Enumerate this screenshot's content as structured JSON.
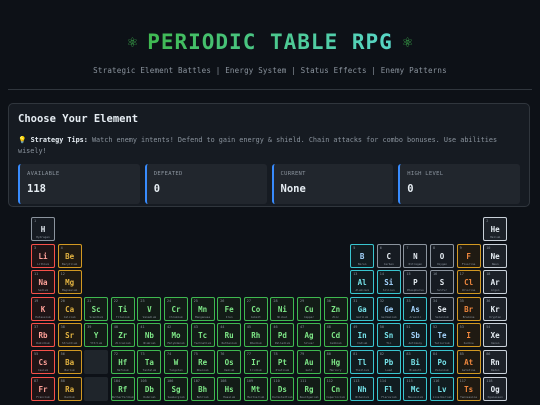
{
  "header": {
    "icon_left": "atom-icon",
    "icon_right": "atom-icon",
    "title": "PERIODIC TABLE RPG",
    "subtitle": "Strategic Element Battles | Energy System | Status Effects | Enemy Patterns"
  },
  "panel": {
    "title": "Choose Your Element",
    "tips_icon": "lightbulb-icon",
    "tips_label": "Strategy Tips:",
    "tips_text": " Watch enemy intents! Defend to gain energy & shield. Chain attacks for combo bonuses. Use abilities wisely!",
    "stats": [
      {
        "label": "AVAILABLE",
        "value": "118"
      },
      {
        "label": "DEFEATED",
        "value": "0"
      },
      {
        "label": "CURRENT",
        "value": "None"
      },
      {
        "label": "HIGH LEVEL",
        "value": "0"
      }
    ]
  },
  "colors": {
    "alkali": "#f85149",
    "alkaline": "#d29922",
    "transition": "#3fb950",
    "post": "#39c5cf",
    "nonmetal": "#8b949e",
    "halogen": "#d29922",
    "noble": "#c9d1d9",
    "stat_accent": "#388bfd"
  },
  "elements": [
    {
      "n": 1,
      "s": "H",
      "name": "Hydrogen",
      "cat": "nonmetal",
      "r": 1,
      "c": 1
    },
    {
      "n": 2,
      "s": "He",
      "name": "Helium",
      "cat": "noble",
      "r": 1,
      "c": 18
    },
    {
      "n": 3,
      "s": "Li",
      "name": "Lithium",
      "cat": "alkali",
      "r": 2,
      "c": 1
    },
    {
      "n": 4,
      "s": "Be",
      "name": "Beryllium",
      "cat": "alkaline",
      "r": 2,
      "c": 2
    },
    {
      "n": 5,
      "s": "B",
      "name": "Boron",
      "cat": "metalloid",
      "r": 2,
      "c": 13
    },
    {
      "n": 6,
      "s": "C",
      "name": "Carbon",
      "cat": "nonmetal",
      "r": 2,
      "c": 14
    },
    {
      "n": 7,
      "s": "N",
      "name": "Nitrogen",
      "cat": "nonmetal",
      "r": 2,
      "c": 15
    },
    {
      "n": 8,
      "s": "O",
      "name": "Oxygen",
      "cat": "nonmetal",
      "r": 2,
      "c": 16
    },
    {
      "n": 9,
      "s": "F",
      "name": "Fluorine",
      "cat": "halogen",
      "r": 2,
      "c": 17
    },
    {
      "n": 10,
      "s": "Ne",
      "name": "Neon",
      "cat": "noble",
      "r": 2,
      "c": 18
    },
    {
      "n": 11,
      "s": "Na",
      "name": "Sodium",
      "cat": "alkali",
      "r": 3,
      "c": 1
    },
    {
      "n": 12,
      "s": "Mg",
      "name": "Magnesium",
      "cat": "alkaline",
      "r": 3,
      "c": 2
    },
    {
      "n": 13,
      "s": "Al",
      "name": "Aluminum",
      "cat": "post",
      "r": 3,
      "c": 13
    },
    {
      "n": 14,
      "s": "Si",
      "name": "Silicon",
      "cat": "metalloid",
      "r": 3,
      "c": 14
    },
    {
      "n": 15,
      "s": "P",
      "name": "Phosphorus",
      "cat": "nonmetal",
      "r": 3,
      "c": 15
    },
    {
      "n": 16,
      "s": "S",
      "name": "Sulfur",
      "cat": "nonmetal",
      "r": 3,
      "c": 16
    },
    {
      "n": 17,
      "s": "Cl",
      "name": "Chlorine",
      "cat": "halogen",
      "r": 3,
      "c": 17
    },
    {
      "n": 18,
      "s": "Ar",
      "name": "Argon",
      "cat": "noble",
      "r": 3,
      "c": 18
    },
    {
      "n": 19,
      "s": "K",
      "name": "Potassium",
      "cat": "alkali",
      "r": 4,
      "c": 1
    },
    {
      "n": 20,
      "s": "Ca",
      "name": "Calcium",
      "cat": "alkaline",
      "r": 4,
      "c": 2
    },
    {
      "n": 21,
      "s": "Sc",
      "name": "Scandium",
      "cat": "transition",
      "r": 4,
      "c": 3
    },
    {
      "n": 22,
      "s": "Ti",
      "name": "Titanium",
      "cat": "transition",
      "r": 4,
      "c": 4
    },
    {
      "n": 23,
      "s": "V",
      "name": "Vanadium",
      "cat": "transition",
      "r": 4,
      "c": 5
    },
    {
      "n": 24,
      "s": "Cr",
      "name": "Chromium",
      "cat": "transition",
      "r": 4,
      "c": 6
    },
    {
      "n": 25,
      "s": "Mn",
      "name": "Manganese",
      "cat": "transition",
      "r": 4,
      "c": 7
    },
    {
      "n": 26,
      "s": "Fe",
      "name": "Iron",
      "cat": "transition",
      "r": 4,
      "c": 8
    },
    {
      "n": 27,
      "s": "Co",
      "name": "Cobalt",
      "cat": "transition",
      "r": 4,
      "c": 9
    },
    {
      "n": 28,
      "s": "Ni",
      "name": "Nickel",
      "cat": "transition",
      "r": 4,
      "c": 10
    },
    {
      "n": 29,
      "s": "Cu",
      "name": "Copper",
      "cat": "transition",
      "r": 4,
      "c": 11
    },
    {
      "n": 30,
      "s": "Zn",
      "name": "Zinc",
      "cat": "transition",
      "r": 4,
      "c": 12
    },
    {
      "n": 31,
      "s": "Ga",
      "name": "Gallium",
      "cat": "post",
      "r": 4,
      "c": 13
    },
    {
      "n": 32,
      "s": "Ge",
      "name": "Germanium",
      "cat": "metalloid",
      "r": 4,
      "c": 14
    },
    {
      "n": 33,
      "s": "As",
      "name": "Arsenic",
      "cat": "metalloid",
      "r": 4,
      "c": 15
    },
    {
      "n": 34,
      "s": "Se",
      "name": "Selenium",
      "cat": "nonmetal",
      "r": 4,
      "c": 16
    },
    {
      "n": 35,
      "s": "Br",
      "name": "Bromine",
      "cat": "halogen",
      "r": 4,
      "c": 17
    },
    {
      "n": 36,
      "s": "Kr",
      "name": "Krypton",
      "cat": "noble",
      "r": 4,
      "c": 18
    },
    {
      "n": 37,
      "s": "Rb",
      "name": "Rubidium",
      "cat": "alkali",
      "r": 5,
      "c": 1
    },
    {
      "n": 38,
      "s": "Sr",
      "name": "Strontium",
      "cat": "alkaline",
      "r": 5,
      "c": 2
    },
    {
      "n": 39,
      "s": "Y",
      "name": "Yttrium",
      "cat": "transition",
      "r": 5,
      "c": 3
    },
    {
      "n": 40,
      "s": "Zr",
      "name": "Zirconium",
      "cat": "transition",
      "r": 5,
      "c": 4
    },
    {
      "n": 41,
      "s": "Nb",
      "name": "Niobium",
      "cat": "transition",
      "r": 5,
      "c": 5
    },
    {
      "n": 42,
      "s": "Mo",
      "name": "Molybdenum",
      "cat": "transition",
      "r": 5,
      "c": 6
    },
    {
      "n": 43,
      "s": "Tc",
      "name": "Technetium",
      "cat": "transition",
      "r": 5,
      "c": 7
    },
    {
      "n": 44,
      "s": "Ru",
      "name": "Ruthenium",
      "cat": "transition",
      "r": 5,
      "c": 8
    },
    {
      "n": 45,
      "s": "Rh",
      "name": "Rhodium",
      "cat": "transition",
      "r": 5,
      "c": 9
    },
    {
      "n": 46,
      "s": "Pd",
      "name": "Palladium",
      "cat": "transition",
      "r": 5,
      "c": 10
    },
    {
      "n": 47,
      "s": "Ag",
      "name": "Silver",
      "cat": "transition",
      "r": 5,
      "c": 11
    },
    {
      "n": 48,
      "s": "Cd",
      "name": "Cadmium",
      "cat": "transition",
      "r": 5,
      "c": 12
    },
    {
      "n": 49,
      "s": "In",
      "name": "Indium",
      "cat": "post",
      "r": 5,
      "c": 13
    },
    {
      "n": 50,
      "s": "Sn",
      "name": "Tin",
      "cat": "post",
      "r": 5,
      "c": 14
    },
    {
      "n": 51,
      "s": "Sb",
      "name": "Antimony",
      "cat": "metalloid",
      "r": 5,
      "c": 15
    },
    {
      "n": 52,
      "s": "Te",
      "name": "Tellurium",
      "cat": "metalloid",
      "r": 5,
      "c": 16
    },
    {
      "n": 53,
      "s": "I",
      "name": "Iodine",
      "cat": "halogen",
      "r": 5,
      "c": 17
    },
    {
      "n": 54,
      "s": "Xe",
      "name": "Xenon",
      "cat": "noble",
      "r": 5,
      "c": 18
    },
    {
      "n": 55,
      "s": "Cs",
      "name": "Cesium",
      "cat": "alkali",
      "r": 6,
      "c": 1
    },
    {
      "n": 56,
      "s": "Ba",
      "name": "Barium",
      "cat": "alkaline",
      "r": 6,
      "c": 2
    },
    {
      "n": 72,
      "s": "Hf",
      "name": "Hafnium",
      "cat": "transition",
      "r": 6,
      "c": 4
    },
    {
      "n": 73,
      "s": "Ta",
      "name": "Tantalum",
      "cat": "transition",
      "r": 6,
      "c": 5
    },
    {
      "n": 74,
      "s": "W",
      "name": "Tungsten",
      "cat": "transition",
      "r": 6,
      "c": 6
    },
    {
      "n": 75,
      "s": "Re",
      "name": "Rhenium",
      "cat": "transition",
      "r": 6,
      "c": 7
    },
    {
      "n": 76,
      "s": "Os",
      "name": "Osmium",
      "cat": "transition",
      "r": 6,
      "c": 8
    },
    {
      "n": 77,
      "s": "Ir",
      "name": "Iridium",
      "cat": "transition",
      "r": 6,
      "c": 9
    },
    {
      "n": 78,
      "s": "Pt",
      "name": "Platinum",
      "cat": "transition",
      "r": 6,
      "c": 10
    },
    {
      "n": 79,
      "s": "Au",
      "name": "Gold",
      "cat": "transition",
      "r": 6,
      "c": 11
    },
    {
      "n": 80,
      "s": "Hg",
      "name": "Mercury",
      "cat": "transition",
      "r": 6,
      "c": 12
    },
    {
      "n": 81,
      "s": "Tl",
      "name": "Thallium",
      "cat": "post",
      "r": 6,
      "c": 13
    },
    {
      "n": 82,
      "s": "Pb",
      "name": "Lead",
      "cat": "post",
      "r": 6,
      "c": 14
    },
    {
      "n": 83,
      "s": "Bi",
      "name": "Bismuth",
      "cat": "post",
      "r": 6,
      "c": 15
    },
    {
      "n": 84,
      "s": "Po",
      "name": "Polonium",
      "cat": "post",
      "r": 6,
      "c": 16
    },
    {
      "n": 85,
      "s": "At",
      "name": "Astatine",
      "cat": "halogen",
      "r": 6,
      "c": 17
    },
    {
      "n": 86,
      "s": "Rn",
      "name": "Radon",
      "cat": "noble",
      "r": 6,
      "c": 18
    },
    {
      "n": 87,
      "s": "Fr",
      "name": "Francium",
      "cat": "alkali",
      "r": 7,
      "c": 1
    },
    {
      "n": 88,
      "s": "Ra",
      "name": "Radium",
      "cat": "alkaline",
      "r": 7,
      "c": 2
    },
    {
      "n": 104,
      "s": "Rf",
      "name": "Rutherfordium",
      "cat": "transition",
      "r": 7,
      "c": 4
    },
    {
      "n": 105,
      "s": "Db",
      "name": "Dubnium",
      "cat": "transition",
      "r": 7,
      "c": 5
    },
    {
      "n": 106,
      "s": "Sg",
      "name": "Seaborgium",
      "cat": "transition",
      "r": 7,
      "c": 6
    },
    {
      "n": 107,
      "s": "Bh",
      "name": "Bohrium",
      "cat": "transition",
      "r": 7,
      "c": 7
    },
    {
      "n": 108,
      "s": "Hs",
      "name": "Hassium",
      "cat": "transition",
      "r": 7,
      "c": 8
    },
    {
      "n": 109,
      "s": "Mt",
      "name": "Meitnerium",
      "cat": "transition",
      "r": 7,
      "c": 9
    },
    {
      "n": 110,
      "s": "Ds",
      "name": "Darmstadtium",
      "cat": "transition",
      "r": 7,
      "c": 10
    },
    {
      "n": 111,
      "s": "Rg",
      "name": "Roentgenium",
      "cat": "transition",
      "r": 7,
      "c": 11
    },
    {
      "n": 112,
      "s": "Cn",
      "name": "Copernicium",
      "cat": "transition",
      "r": 7,
      "c": 12
    },
    {
      "n": 113,
      "s": "Nh",
      "name": "Nihonium",
      "cat": "post",
      "r": 7,
      "c": 13
    },
    {
      "n": 114,
      "s": "Fl",
      "name": "Flerovium",
      "cat": "post",
      "r": 7,
      "c": 14
    },
    {
      "n": 115,
      "s": "Mc",
      "name": "Moscovium",
      "cat": "post",
      "r": 7,
      "c": 15
    },
    {
      "n": 116,
      "s": "Lv",
      "name": "Livermorium",
      "cat": "post",
      "r": 7,
      "c": 16
    },
    {
      "n": 117,
      "s": "Ts",
      "name": "Tennessine",
      "cat": "halogen",
      "r": 7,
      "c": 17
    },
    {
      "n": 118,
      "s": "Og",
      "name": "Oganesson",
      "cat": "noble",
      "r": 7,
      "c": 18
    }
  ],
  "placeholders": [
    {
      "r": 6,
      "c": 3
    },
    {
      "r": 7,
      "c": 3
    }
  ]
}
